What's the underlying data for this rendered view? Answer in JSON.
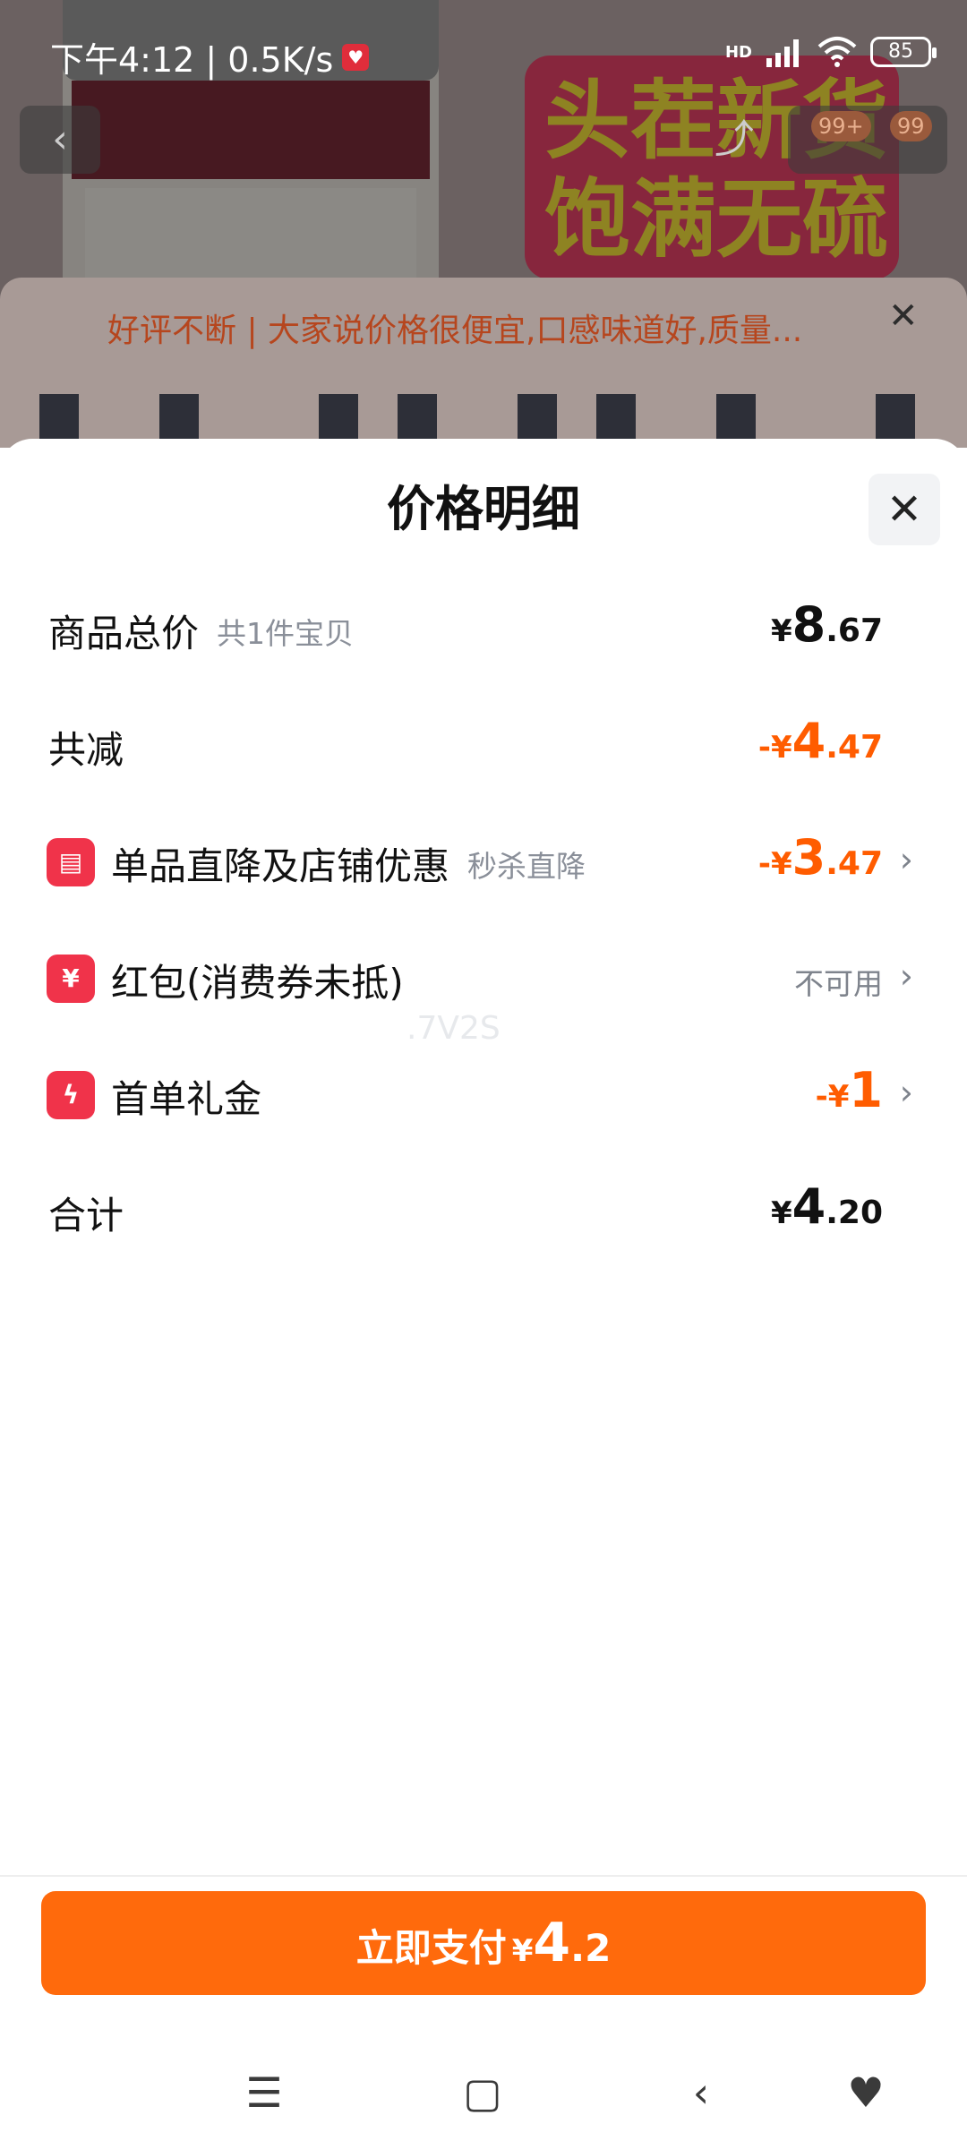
{
  "status_bar": {
    "time_speed": "下午4:12 | 0.5K/s",
    "app_icon": "app-notification-icon",
    "hd": "HD",
    "battery": "85"
  },
  "product": {
    "banner_line1": "头茬新货",
    "banner_line2": "饱满无硫",
    "badge1": "99+",
    "badge2": "99",
    "review": "好评不断 | 大家说价格很便宜,口感味道好,质量..."
  },
  "sheet": {
    "title": "价格明细",
    "rows": [
      {
        "label": "商品总价",
        "sub": "共1件宝贝",
        "sym": "¥",
        "int": "8",
        "dec": ".67"
      },
      {
        "label": "共减",
        "sym": "-¥",
        "int": "4",
        "dec": ".47"
      },
      {
        "label": "单品直降及店铺优惠",
        "sub": "秒杀直降",
        "sym": "-¥",
        "int": "3",
        "dec": ".47",
        "icon": "store-icon"
      },
      {
        "label": "红包(消费券未抵)",
        "value": "不可用",
        "icon": "red-packet-icon"
      },
      {
        "label": "首单礼金",
        "sym": "-¥",
        "int": "1",
        "icon": "lightning-icon"
      },
      {
        "label": "合计",
        "sym": "¥",
        "int": "4",
        "dec": ".20"
      }
    ],
    "watermark": ".7V2S"
  },
  "pay": {
    "label": "立即支付",
    "sym": "¥",
    "int": "4",
    "dec": ".2"
  },
  "colors": {
    "accent": "#ff6a0c",
    "discount": "#ff5c00",
    "icon_red": "#f0334a"
  }
}
